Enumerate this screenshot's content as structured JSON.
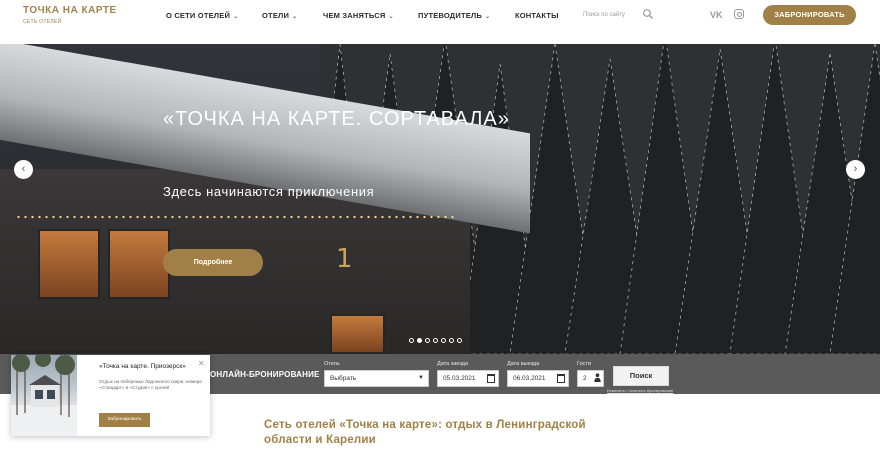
{
  "brand": {
    "logo_title": "ТОЧКА НА КАРТЕ",
    "logo_subtitle": "СЕТЬ ОТЕЛЕЙ",
    "accent": "#a08046"
  },
  "nav": {
    "items": [
      {
        "label": "О СЕТИ ОТЕЛЕЙ",
        "has_dropdown": true
      },
      {
        "label": "ОТЕЛИ",
        "has_dropdown": true
      },
      {
        "label": "ЧЕМ ЗАНЯТЬСЯ",
        "has_dropdown": true
      },
      {
        "label": "ПУТЕВОДИТЕЛЬ",
        "has_dropdown": true
      },
      {
        "label": "КОНТАКТЫ",
        "has_dropdown": false
      }
    ],
    "search_placeholder": "Поиск по сайту",
    "social": [
      "vk-icon",
      "instagram-icon"
    ],
    "book_label": "ЗАБРОНИРОВАТЬ"
  },
  "hero": {
    "title": "«ТОЧКА НА КАРТЕ. СОРТАВАЛА»",
    "subtitle": "Здесь начинаются приключения",
    "button_label": "Подробнее",
    "house_number": "1",
    "slides_total": 7,
    "active_slide": 2
  },
  "booking": {
    "label": "ОНЛАЙН-БРОНИРОВАНИЕ",
    "hotel_label": "Отель",
    "hotel_value": "Выбрать",
    "checkin_label": "Дата заезда",
    "checkin_value": "05.03.2021",
    "checkout_label": "Дата выезда",
    "checkout_value": "06.03.2021",
    "guests_label": "Гости",
    "guests_value": "2",
    "search_label": "Поиск",
    "manage_link": "Изменить / отменить бронирование"
  },
  "promo": {
    "title": "«Точка на карте. Приозерск»",
    "text": "Отдых на побережье Ладожского озера: номера «Стандарт» и «Студия» с кухней",
    "button_label": "Забронировать"
  },
  "section": {
    "title": "Сеть отелей «Точка на карте»: отдых в Ленинградской области и Карелии"
  }
}
